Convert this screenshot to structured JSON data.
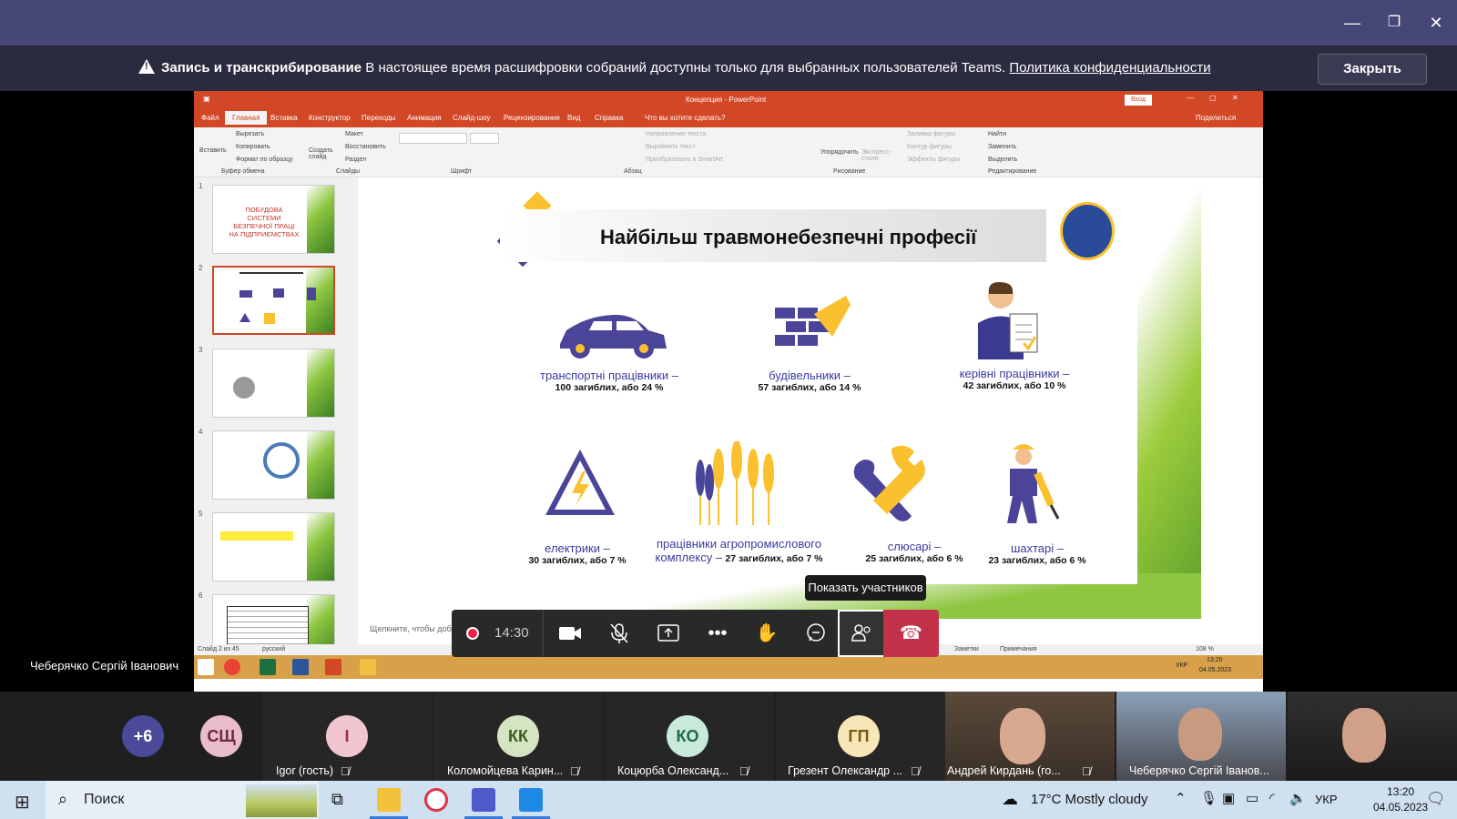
{
  "window": {
    "minimize": "—",
    "maximize": "❐",
    "close": "✕"
  },
  "banner": {
    "title": "Запись и транскрибирование",
    "message": "В настоящее время расшифровки собраний доступны только для выбранных пользователей Teams.",
    "link": "Политика конфиденциальности",
    "close_label": "Закрыть"
  },
  "powerpoint": {
    "title": "Концепция - PowerPoint",
    "login": "Вход",
    "share": "Поделиться",
    "tabs": [
      "Файл",
      "Главная",
      "Вставка",
      "Конструктор",
      "Переходы",
      "Анимация",
      "Слайд-шоу",
      "Рецензирование",
      "Вид",
      "Справка",
      "Что вы хотите сделать?"
    ],
    "ribbon": {
      "paste": "Вставить",
      "cut": "Вырезать",
      "copy": "Копировать",
      "format": "Формат по образцу",
      "clipboard": "Буфер обмена",
      "new_slide": "Создать слайд",
      "layout": "Макет",
      "reset": "Восстановить",
      "section": "Раздел",
      "slides": "Слайды",
      "font": "Шрифт",
      "paragraph": "Абзац",
      "text_dir": "Направление текста",
      "align_text": "Выровнять текст",
      "smartart": "Преобразовать в SmartArt",
      "arrange": "Упорядочить",
      "quick_styles": "Экспресс-стили",
      "fill": "Заливка фигуры",
      "outline": "Контур фигуры",
      "effects": "Эффекты фигуры",
      "drawing": "Рисование",
      "find": "Найти",
      "replace": "Заменить",
      "select": "Выделить",
      "editing": "Редактирование"
    },
    "thumb_numbers": [
      "1",
      "2",
      "3",
      "4",
      "5",
      "6"
    ],
    "thumb1_text": "ПОБУДОВА СИСТЕМИ БЕЗПЕЧНОЇ ПРАЦІ НА ПІДПРИЄМСТВАХ",
    "notes_hint": "Щелкните, чтобы доба",
    "status": {
      "slide": "Слайд 2 из 45",
      "lang": "русский",
      "notes": "Заметки",
      "comments": "Примечания",
      "zoom": "108 %"
    },
    "taskbar_lang": "УКР",
    "taskbar_time": "13:20",
    "taskbar_date": "04.05.2023"
  },
  "slide": {
    "title": "Найбільш травмонебезпечні професії",
    "items": [
      {
        "name": "транспортні працівники –",
        "stat": "100 загиблих, або 24 %"
      },
      {
        "name": "будівельники –",
        "stat": "57 загиблих, або 14 %"
      },
      {
        "name": "керівні працівники –",
        "stat": "42 загиблих, або 10 %"
      },
      {
        "name": "електрики –",
        "stat": "30 загиблих, або 7 %"
      },
      {
        "name": "працівники агропромислового",
        "name2": "комплексу –",
        "stat": "27 загиблих, або 7 %"
      },
      {
        "name": "слюсарі –",
        "stat": "25 загиблих, або 6 %"
      },
      {
        "name": "шахтарі –",
        "stat": "23 загиблих, або 6 %"
      }
    ]
  },
  "call": {
    "timer": "14:30",
    "tooltip": "Показать участников",
    "presenter": "Чеберячко Сергій Іванович"
  },
  "participants": [
    {
      "initials": "+6",
      "color": "#4b4a9a",
      "text_color": "#ffffff"
    },
    {
      "initials": "СЩ",
      "color": "#e8bcc8",
      "text_color": "#6a2a40"
    },
    {
      "initials": "І",
      "color": "#f2c6cf",
      "text_color": "#9a3050",
      "name": "Igor (гость)"
    },
    {
      "initials": "КК",
      "color": "#d6e4c3",
      "text_color": "#3a5a20",
      "name": "Коломойцева Карин..."
    },
    {
      "initials": "КО",
      "color": "#c8ead9",
      "text_color": "#1f6a45",
      "name": "Коцюрба Олександ..."
    },
    {
      "initials": "ГП",
      "color": "#f7e6b8",
      "text_color": "#7a5a10",
      "name": "Грезент Олександр ..."
    },
    {
      "name": "Андрей Кирдань (го..."
    },
    {
      "name": "Чеберячко Сергій Іванов..."
    },
    {
      "name": ""
    }
  ],
  "taskbar": {
    "search": "Поиск",
    "weather": "17°C  Mostly cloudy",
    "lang": "УКР",
    "time": "13:20",
    "date": "04.05.2023"
  }
}
